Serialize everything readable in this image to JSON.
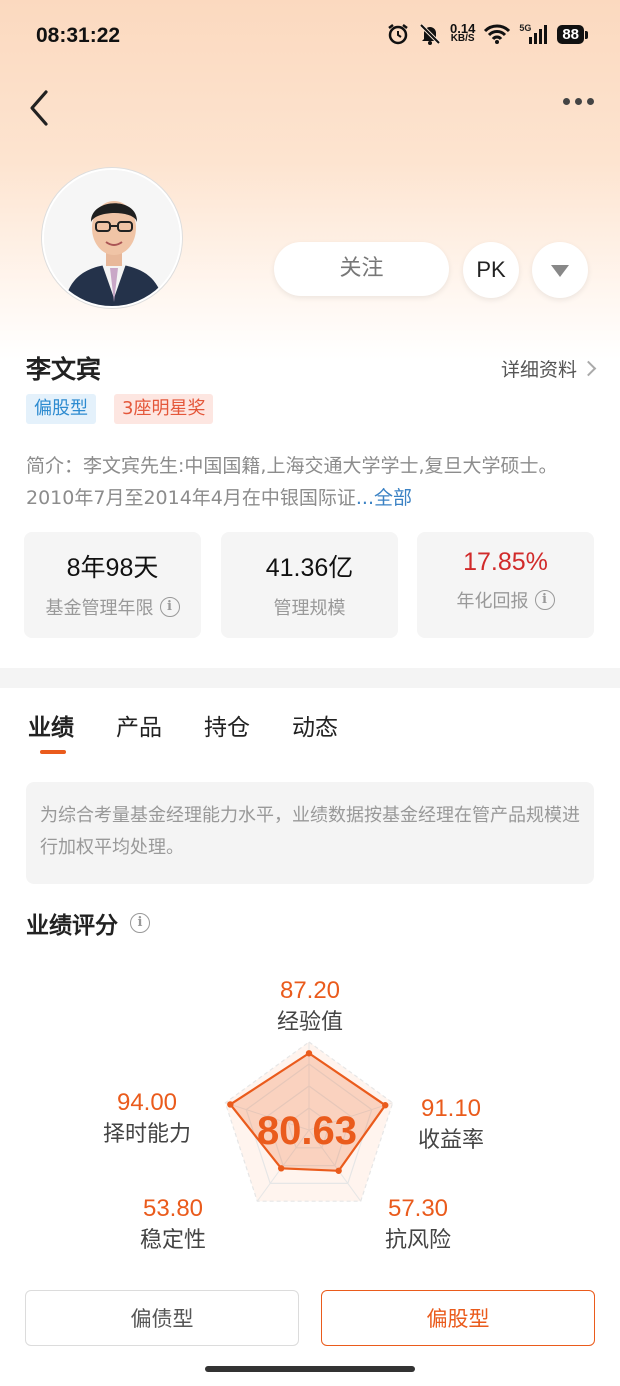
{
  "status_bar": {
    "time": "08:31:22",
    "net_speed_value": "0.14",
    "net_speed_unit": "KB/S",
    "signal_label": "5G",
    "battery": "88"
  },
  "header": {
    "follow_label": "关注",
    "pk_label": "PK"
  },
  "manager": {
    "name": "李文宾",
    "detail_link": "详细资料",
    "tags": [
      "偏股型",
      "3座明星奖"
    ],
    "intro_text": "简介：李文宾先生:中国国籍,上海交通大学学士,复旦大学硕士。2010年7月至2014年4月在中银国际证",
    "intro_ellipsis": "...",
    "intro_more": "全部"
  },
  "stats": [
    {
      "value": "8年98天",
      "label": "基金管理年限",
      "has_info": true
    },
    {
      "value": "41.36亿",
      "label": "管理规模",
      "has_info": false
    },
    {
      "value": "17.85%",
      "label": "年化回报",
      "has_info": true
    }
  ],
  "tabs": [
    "业绩",
    "产品",
    "持仓",
    "动态"
  ],
  "active_tab": "业绩",
  "notice": "为综合考量基金经理能力水平，业绩数据按基金经理在管产品规模进行加权平均处理。",
  "score_section": {
    "title": "业绩评分",
    "total": "80.63",
    "dimensions": [
      {
        "name": "经验值",
        "score": "87.20",
        "value": 87.2
      },
      {
        "name": "收益率",
        "score": "91.10",
        "value": 91.1
      },
      {
        "name": "抗风险",
        "score": "57.30",
        "value": 57.3
      },
      {
        "name": "稳定性",
        "score": "53.80",
        "value": 53.8
      },
      {
        "name": "择时能力",
        "score": "94.00",
        "value": 94.0
      }
    ]
  },
  "bottom_buttons": [
    "偏债型",
    "偏股型"
  ],
  "colors": {
    "accent": "#ea5b1c",
    "positive_red": "#d12b2b",
    "tag_blue": "#2d8bd0",
    "tag_red": "#e4573a"
  }
}
